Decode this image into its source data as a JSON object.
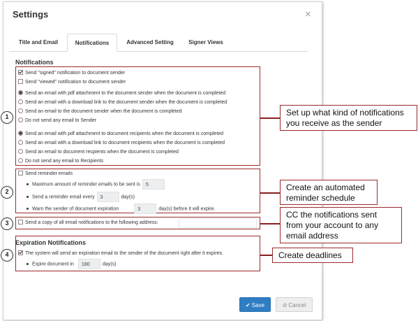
{
  "dialog": {
    "title": "Settings",
    "close_icon": "×"
  },
  "tabs": [
    {
      "label": "Title and Email"
    },
    {
      "label": "Notifications"
    },
    {
      "label": "Advanced Setting"
    },
    {
      "label": "Signer Views"
    }
  ],
  "notifications": {
    "title": "Notifications",
    "checkboxes": [
      {
        "label": "Send \"signed\" notification to document sender",
        "checked": true
      },
      {
        "label": "Send \"viewed\" notification to document sender",
        "checked": false
      }
    ],
    "sender_options": [
      {
        "label": "Send an email with pdf attachment to the document sender when the document is completed",
        "selected": true
      },
      {
        "label": "Send an email with a download link to the document sender when the document is completed",
        "selected": false
      },
      {
        "label": "Send an email to the document sender when the document is completed",
        "selected": false
      },
      {
        "label": "Do not send any email to Sender",
        "selected": false
      }
    ],
    "recipient_options": [
      {
        "label": "Send an email with pdf attachment to document recipients when the document is completed",
        "selected": true
      },
      {
        "label": "Send an email with a download link to document recipients when the document is completed",
        "selected": false
      },
      {
        "label": "Send an email to document recpients when the document is completed",
        "selected": false
      },
      {
        "label": "Do not send any email to Recipients",
        "selected": false
      }
    ]
  },
  "reminders": {
    "label": "Send reminder emails",
    "checked": false,
    "max_label": "Maximum amount of reminder emails to be sent is",
    "max_value": "5",
    "every_label": "Send a reminder email every",
    "every_value": "3",
    "every_unit": "day(s)",
    "warn_label": "Warn the sender of document expiration",
    "warn_value": "3",
    "warn_unit": "day(s) before it will expire."
  },
  "cc": {
    "label": "Send a copy of all email notifications to the following address:",
    "checked": false
  },
  "expiration": {
    "title": "Expiration Notifications",
    "label": "The system will send an expiration email to the sender of the document right after it expires.",
    "checked": true,
    "expire_label": "Expire document in",
    "expire_value": "180",
    "expire_unit": "day(s)"
  },
  "callouts": [
    {
      "badge": "1",
      "text": "Set up what kind of notifications you receive as the sender"
    },
    {
      "badge": "2",
      "text": "Create an automated reminder schedule"
    },
    {
      "badge": "3",
      "text": "CC the notifications sent from your account to any email address"
    },
    {
      "badge": "4",
      "text": "Create deadlines"
    }
  ],
  "buttons": {
    "save_label": "Save",
    "save_icon": "✔",
    "cancel_label": "Cancel",
    "cancel_icon": "⊘"
  },
  "colors": {
    "accent_blue": "#2f7ec3",
    "annotation_red": "#9b2b2b"
  }
}
